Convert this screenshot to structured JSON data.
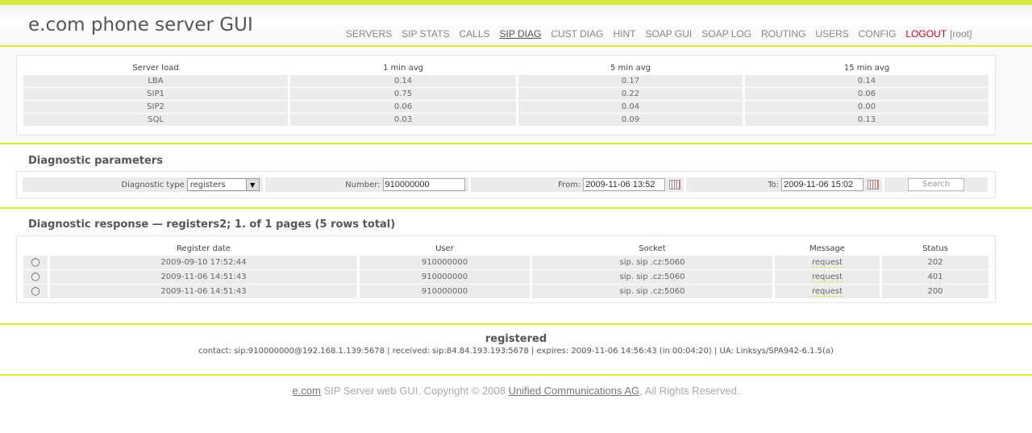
{
  "app": {
    "title": "e.com phone server GUI"
  },
  "nav": {
    "items": [
      "SERVERS",
      "SIP STATS",
      "CALLS",
      "SIP DIAG",
      "CUST DIAG",
      "HINT",
      "SOAP GUI",
      "SOAP LOG",
      "ROUTING",
      "USERS",
      "CONFIG"
    ],
    "active": "SIP DIAG",
    "logout": "LOGOUT",
    "user": "[root]"
  },
  "server_load": {
    "headers": [
      "Server load",
      "1 min avg",
      "5 min avg",
      "15 min avg"
    ],
    "rows": [
      [
        "LBA",
        "0.14",
        "0.17",
        "0.14"
      ],
      [
        "SIP1",
        "0.75",
        "0.22",
        "0.06"
      ],
      [
        "SIP2",
        "0.06",
        "0.04",
        "0.00"
      ],
      [
        "SQL",
        "0.03",
        "0.09",
        "0.13"
      ]
    ]
  },
  "diag_params": {
    "title": "Diagnostic parameters",
    "type_label": "Diagnostic type",
    "type_value": "registers",
    "number_label": "Number:",
    "number_value": "910000000",
    "from_label": "From:",
    "from_value": "2009-11-06 13:52",
    "to_label": "To:",
    "to_value": "2009-11-06 15:02",
    "search_label": "Search"
  },
  "diag_response": {
    "title": "Diagnostic response — registers2; 1. of 1 pages (5 rows total)",
    "headers": [
      "Register date",
      "User",
      "Socket",
      "Message",
      "Status"
    ],
    "rows": [
      {
        "icon": "bulb-icon",
        "date": "2009-09-10 17:52:44",
        "user": "910000000",
        "socket": "sip. sip .cz:5060",
        "message": "request",
        "status": "202"
      },
      {
        "icon": "bulb-icon",
        "date": "2009-11-06 14:51:43",
        "user": "910000000",
        "socket": "sip. sip .cz:5060",
        "message": "request",
        "status": "401"
      },
      {
        "icon": "bulb-icon",
        "date": "2009-11-06 14:51:43",
        "user": "910000000",
        "socket": "sip. sip .cz:5060",
        "message": "request",
        "status": "200"
      }
    ]
  },
  "registered": {
    "title": "registered",
    "detail": "contact: sip:910000000@192.168.1.139:5678 | received: sip:84.84.193.193:5678 | expires: 2009-11-06 14:56:43 (in 00:04:20) | UA: Linksys/SPA942-6.1.5(a)"
  },
  "footer": {
    "brand": "e.com",
    "text1": " SIP Server web GUI. Copyright © 2008 ",
    "company": "Unified Communications AG",
    "text2": ", All Rights Reserved."
  },
  "colors": {
    "accent": "#d7ea3c",
    "logout": "#d7001a"
  }
}
